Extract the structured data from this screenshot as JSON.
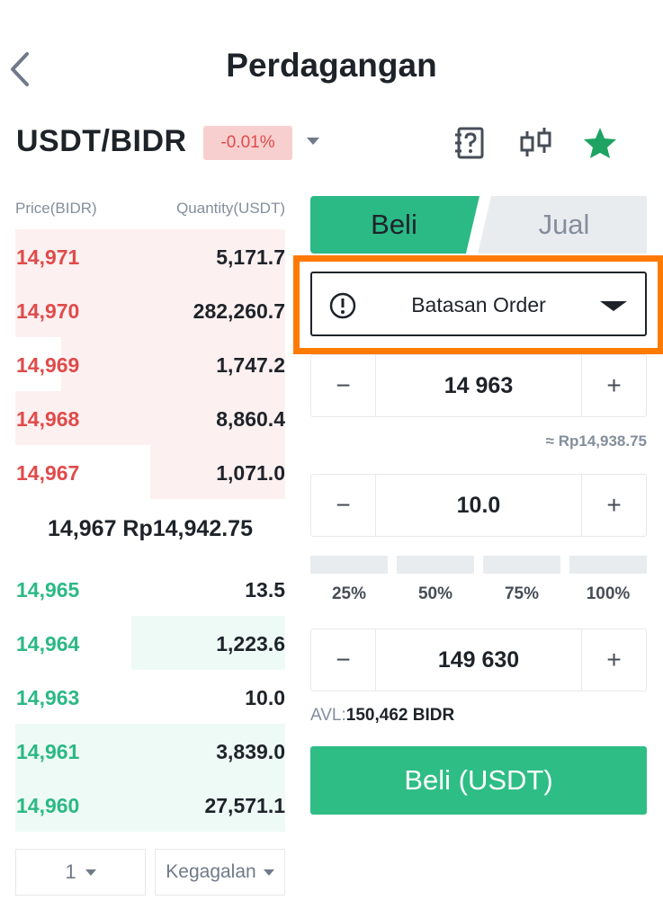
{
  "header": {
    "title": "Perdagangan"
  },
  "pair": {
    "name": "USDT/BIDR",
    "change": "-0.01%"
  },
  "orderbook": {
    "price_header": "Price(BIDR)",
    "qty_header": "Quantity(USDT)",
    "asks": [
      {
        "price": "14,971",
        "qty": "5,171.7",
        "depth": 1.0
      },
      {
        "price": "14,970",
        "qty": "282,260.7",
        "depth": 1.0
      },
      {
        "price": "14,969",
        "qty": "1,747.2",
        "depth": 0.83
      },
      {
        "price": "14,968",
        "qty": "8,860.4",
        "depth": 1.0
      },
      {
        "price": "14,967",
        "qty": "1,071.0",
        "depth": 0.5
      }
    ],
    "mid_price": "14,967 Rp14,942.75",
    "bids": [
      {
        "price": "14,965",
        "qty": "13.5",
        "depth": 0.0
      },
      {
        "price": "14,964",
        "qty": "1,223.6",
        "depth": 0.57
      },
      {
        "price": "14,963",
        "qty": "10.0",
        "depth": 0.0
      },
      {
        "price": "14,961",
        "qty": "3,839.0",
        "depth": 1.0
      },
      {
        "price": "14,960",
        "qty": "27,571.1",
        "depth": 1.0
      }
    ],
    "depth_select": "1",
    "view_select": "Kegagalan"
  },
  "form": {
    "tab_buy": "Beli",
    "tab_sell": "Jual",
    "order_type": "Batasan Order",
    "price_value": "14 963",
    "price_approx": "≈ Rp14,938.75",
    "amount_value": "10.0",
    "percentages": [
      "25%",
      "50%",
      "75%",
      "100%"
    ],
    "total_value": "149 630",
    "avl_label": "AVL:",
    "avl_value": "150,462 BIDR",
    "buy_button": "Beli (USDT)",
    "minus": "−",
    "plus": "+"
  },
  "colors": {
    "buy": "#2ebd85",
    "sell": "#e04b4b",
    "highlight": "#ff7a00"
  }
}
